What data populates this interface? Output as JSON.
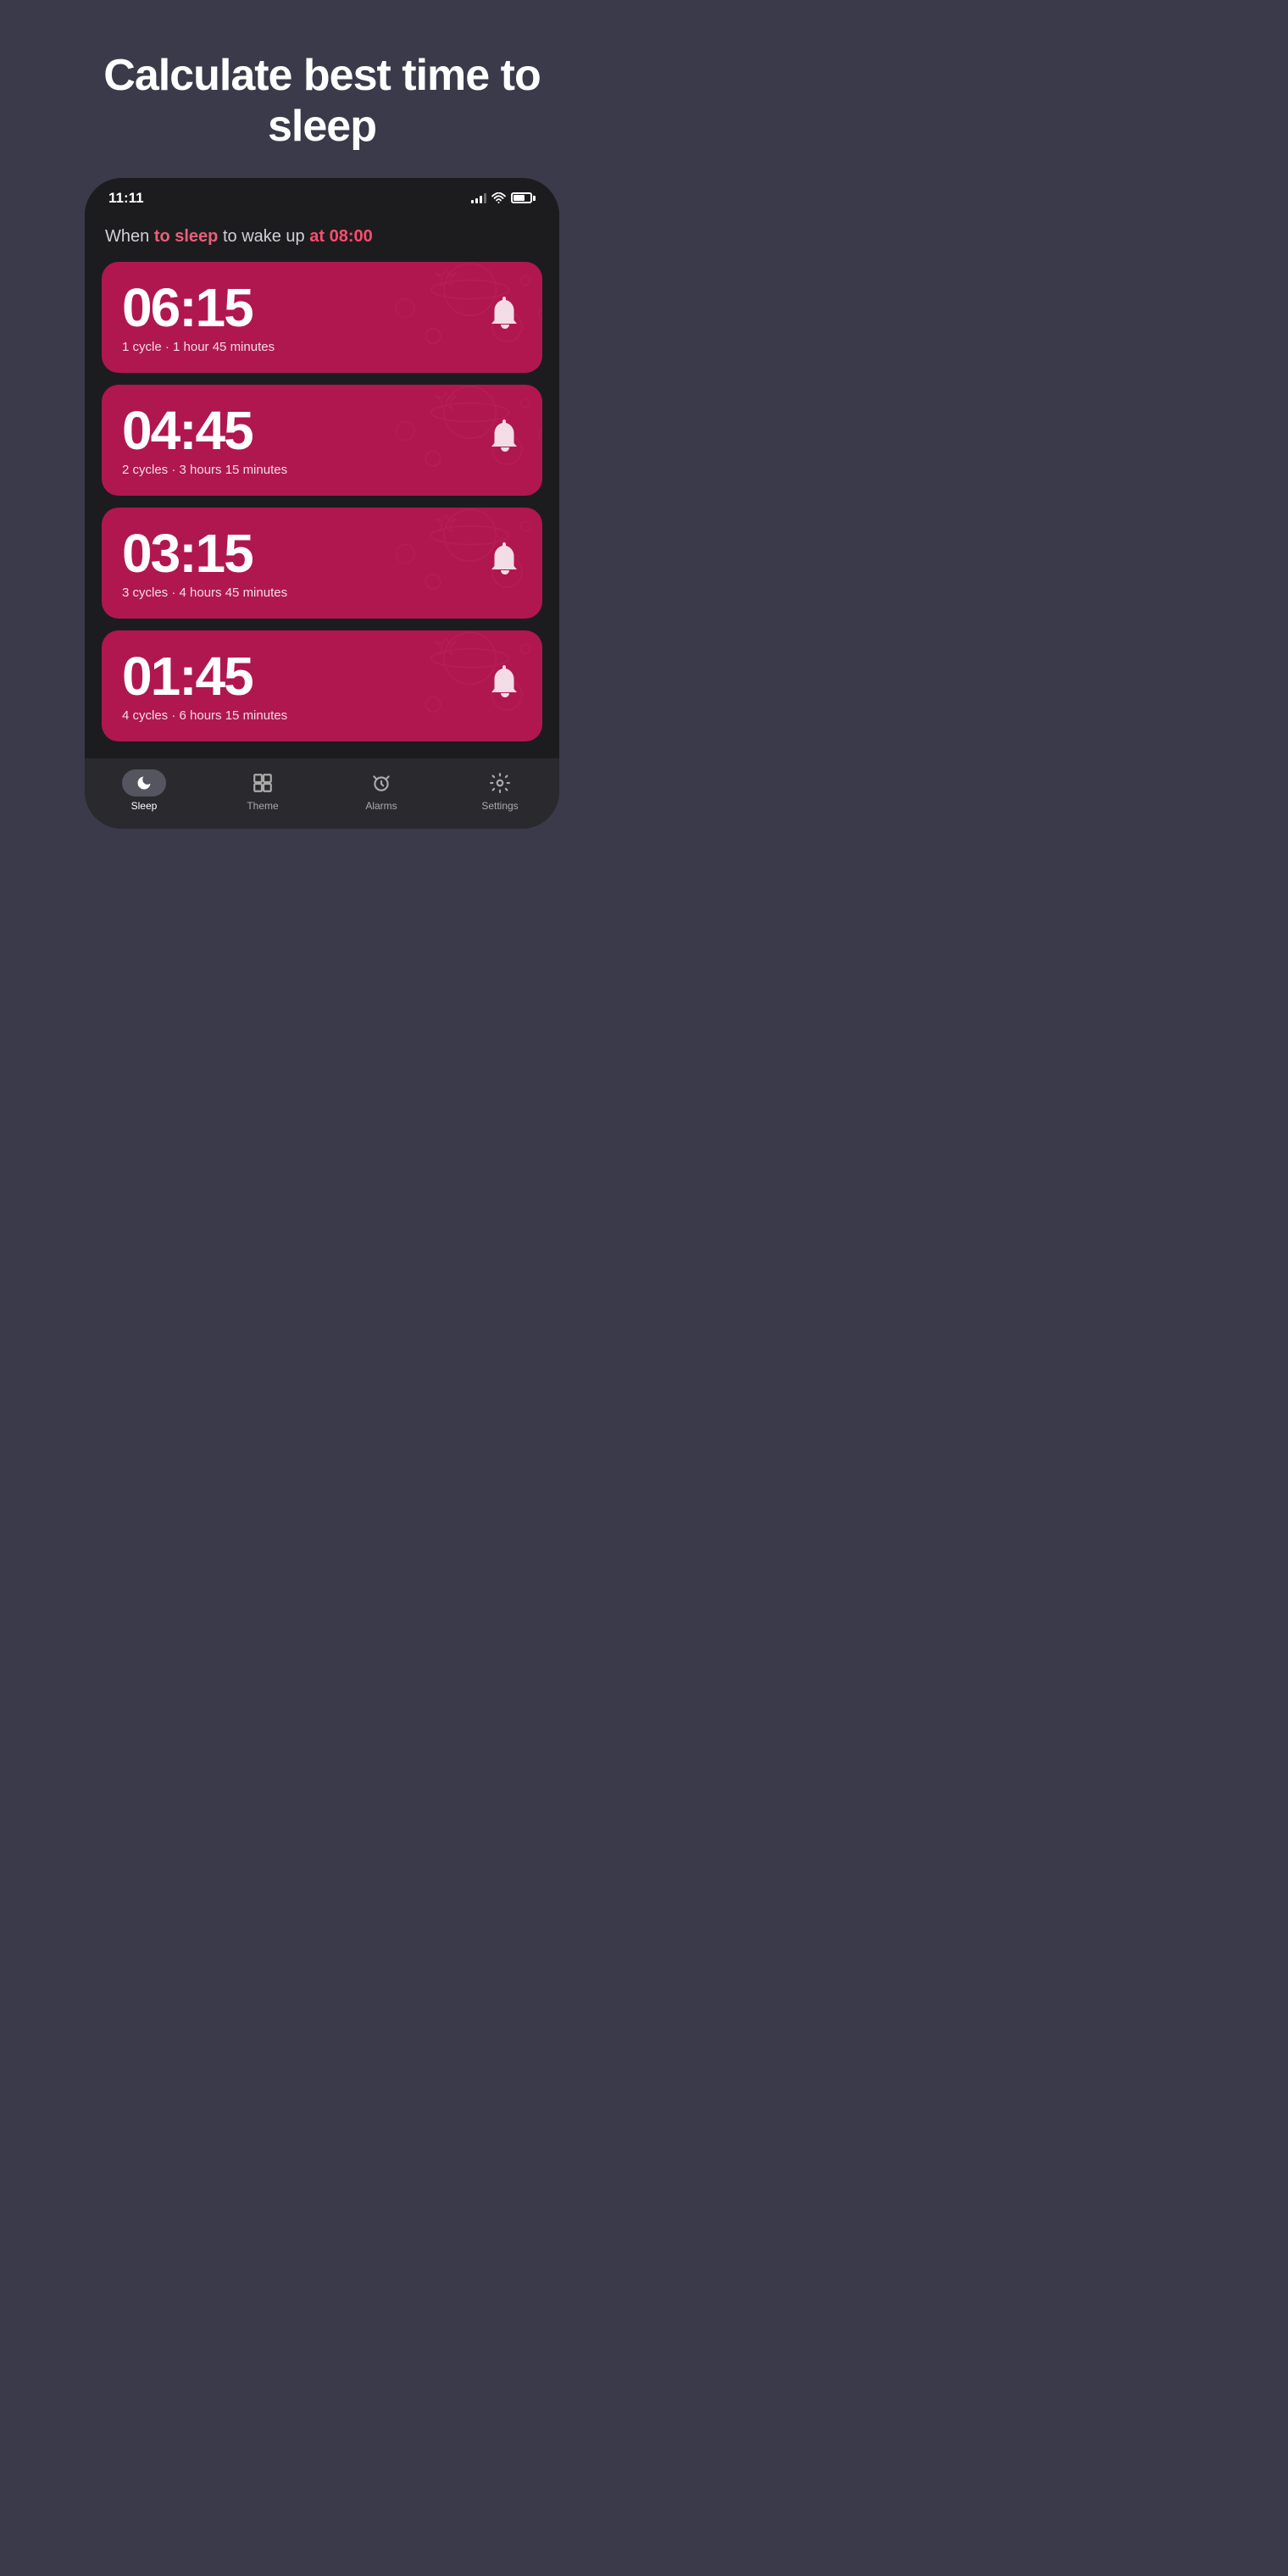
{
  "hero": {
    "title": "Calculate best time to sleep"
  },
  "phone": {
    "status": {
      "time": "11:11"
    },
    "subtitle": {
      "prefix": "When ",
      "highlight1": "to sleep",
      "middle": " to wake up ",
      "highlight2": "at 08:00"
    },
    "cards": [
      {
        "time": "06:15",
        "description": "1 cycle · 1 hour 45 minutes"
      },
      {
        "time": "04:45",
        "description": "2 cycles · 3 hours 15 minutes"
      },
      {
        "time": "03:15",
        "description": "3 cycles · 4 hours 45 minutes"
      },
      {
        "time": "01:45",
        "description": "4 cycles · 6 hours 15 minutes"
      }
    ],
    "nav": {
      "items": [
        {
          "label": "Sleep",
          "active": true
        },
        {
          "label": "Theme",
          "active": false
        },
        {
          "label": "Alarms",
          "active": false
        },
        {
          "label": "Settings",
          "active": false
        }
      ]
    }
  }
}
